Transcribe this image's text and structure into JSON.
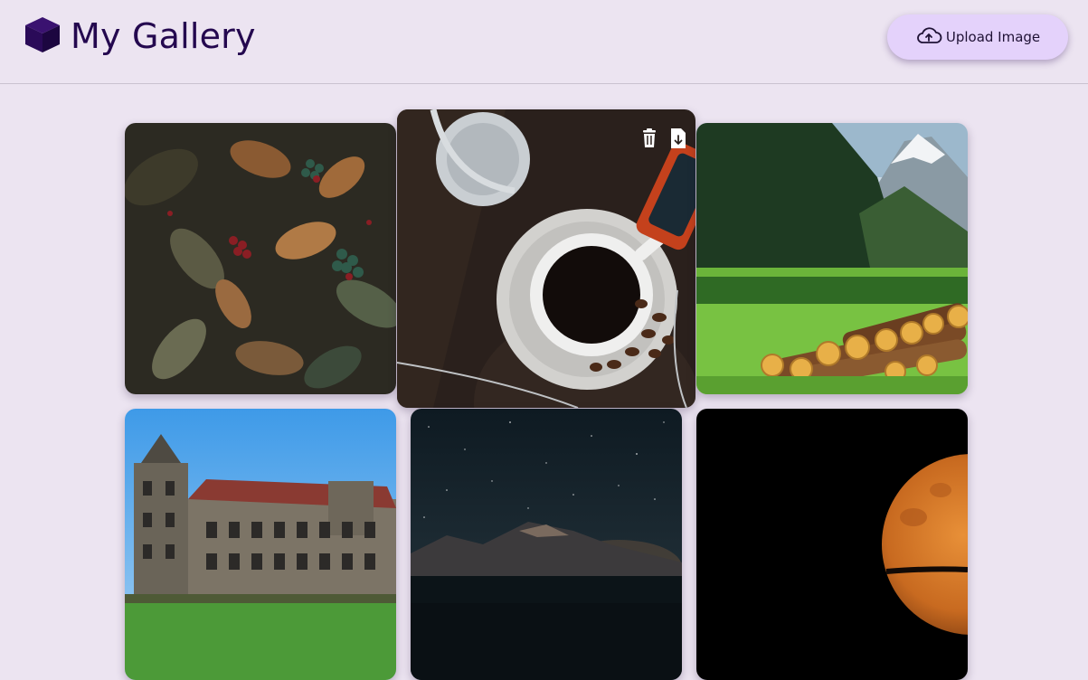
{
  "header": {
    "title": "My Gallery",
    "logo_icon": "cube-icon",
    "upload_label": "Upload Image",
    "upload_icon": "cloud-upload-icon"
  },
  "gallery": {
    "images": [
      {
        "subject": "berries-leaves"
      },
      {
        "subject": "coffee-headphones",
        "hovered": true,
        "actions": [
          "delete-icon",
          "download-icon"
        ]
      },
      {
        "subject": "mountain-logs"
      },
      {
        "subject": "building"
      },
      {
        "subject": "night-sky"
      },
      {
        "subject": "moon"
      }
    ]
  },
  "colors": {
    "background": "#ece4f1",
    "title": "#24084f",
    "button_bg": "#e4d2fb"
  }
}
